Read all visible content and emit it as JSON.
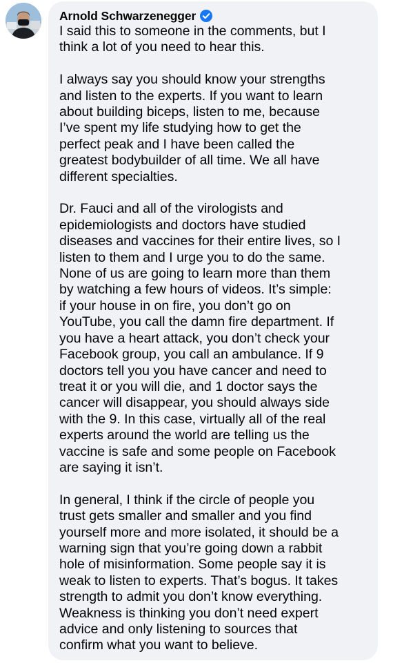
{
  "comment": {
    "author": "Arnold Schwarzenegger",
    "verified_icon": "verified-badge-icon",
    "avatar_icon": "profile-photo",
    "colors": {
      "bubble": "#f0f2f5",
      "text": "#050505",
      "verified": "#1877f2"
    },
    "paragraphs": [
      "I said this to someone in the comments, but I\nthink a lot of you need to hear this.",
      "I always say you should know your strengths\nand listen to the experts. If you want to learn\nabout building biceps, listen to me, because\nI’ve spent my life studying how to get the\nperfect peak and I have been called the\ngreatest bodybuilder of all time. We all have\ndifferent specialties.",
      "Dr. Fauci and all of the virologists and\nepidemiologists and doctors have studied\ndiseases and vaccines for their entire lives, so I\nlisten to them and I urge you to do the same.\nNone of us are going to learn more than them\nby watching a few hours of videos. It’s simple:\nif your house in on fire, you don’t go on\nYouTube, you call the damn fire department. If\nyou have a heart attack, you don’t check your\nFacebook group, you call an ambulance. If 9\ndoctors tell you you have cancer and need to\ntreat it or you will die, and 1 doctor says the\ncancer will disappear, you should always side\nwith the 9. In this case, virtually all of the real\nexperts around the world are telling us the\nvaccine is safe and some people on Facebook\nare saying it isn’t.",
      "In general, I think if the circle of people you\ntrust gets smaller and smaller and you find\nyourself more and more isolated, it should be a\nwarning sign that you’re going down a rabbit\nhole of misinformation. Some people say it is\nweak to listen to experts. That’s bogus. It takes\nstrength to admit you don’t know everything.\nWeakness is thinking you don’t need expert\nadvice and only listening to sources that\nconfirm what you want to believe."
    ]
  }
}
